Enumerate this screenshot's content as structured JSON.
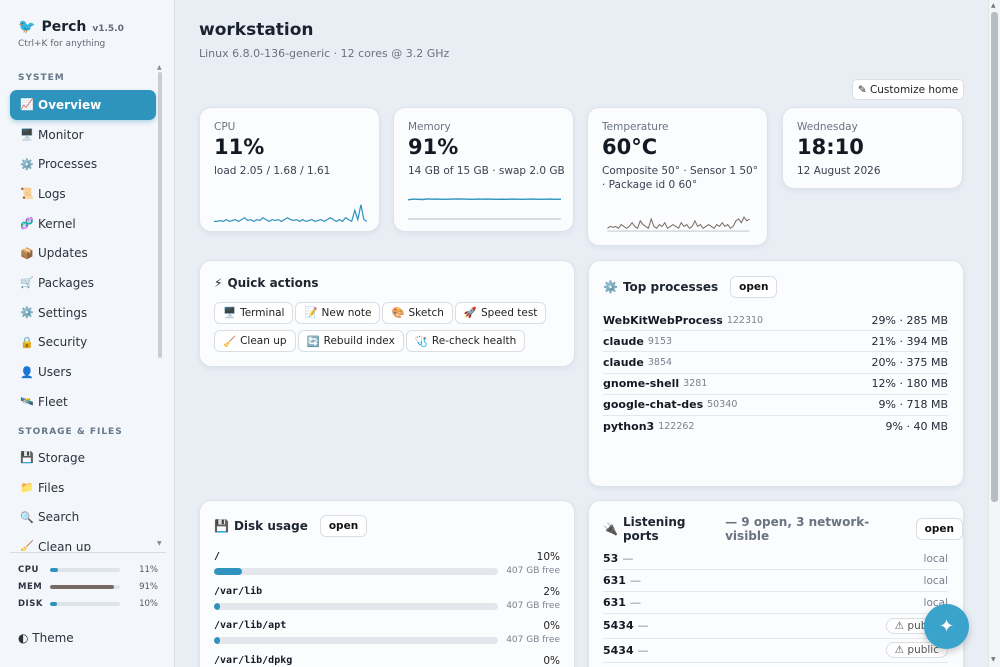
{
  "brand": {
    "icon": "bird-icon",
    "name": "Perch",
    "version": "v1.5.0",
    "hint": "Ctrl+K for anything"
  },
  "sidebar": {
    "system_title": "SYSTEM",
    "system_items": [
      {
        "icon": "📈",
        "label": "Overview",
        "active": true
      },
      {
        "icon": "🖥️",
        "label": "Monitor"
      },
      {
        "icon": "⚙️",
        "label": "Processes"
      },
      {
        "icon": "📜",
        "label": "Logs"
      },
      {
        "icon": "🧬",
        "label": "Kernel"
      },
      {
        "icon": "📦",
        "label": "Updates"
      },
      {
        "icon": "🛒",
        "label": "Packages"
      },
      {
        "icon": "⚙️",
        "label": "Settings"
      },
      {
        "icon": "🔒",
        "label": "Security"
      },
      {
        "icon": "👤",
        "label": "Users"
      },
      {
        "icon": "🛰️",
        "label": "Fleet"
      }
    ],
    "storage_title": "STORAGE & FILES",
    "storage_items": [
      {
        "icon": "💾",
        "label": "Storage"
      },
      {
        "icon": "📁",
        "label": "Files"
      },
      {
        "icon": "🔍",
        "label": "Search"
      },
      {
        "icon": "🧹",
        "label": "Clean up"
      }
    ],
    "meters": [
      {
        "label": "CPU",
        "value": "11%",
        "fraction": 0.11,
        "color": "#2e93bd"
      },
      {
        "label": "MEM",
        "value": "91%",
        "fraction": 0.91,
        "color": "#7a6a64"
      },
      {
        "label": "DISK",
        "value": "10%",
        "fraction": 0.1,
        "color": "#2e93bd"
      }
    ],
    "theme_label": "◐ Theme"
  },
  "header": {
    "title": "workstation",
    "subtitle": "Linux 6.8.0-136-generic · 12 cores @ 3.2 GHz",
    "customize_label": "✎ Customize home"
  },
  "stats": {
    "cpu": {
      "label": "CPU",
      "value": "11%",
      "sub": "load 2.05 / 1.68 / 1.61"
    },
    "memory": {
      "label": "Memory",
      "value": "91%",
      "sub": "14 GB of 15 GB · swap 2.0 GB"
    },
    "temperature": {
      "label": "Temperature",
      "value": "60°C",
      "sub": "Composite 50° · Sensor 1 50° · Package id 0 60°"
    },
    "clock": {
      "label": "Wednesday",
      "value": "18:10",
      "sub": "12 August 2026"
    }
  },
  "quick_actions": {
    "title": "Quick actions",
    "icon": "⚡",
    "buttons": [
      {
        "icon": "🖥️",
        "label": "Terminal"
      },
      {
        "icon": "📝",
        "label": "New note"
      },
      {
        "icon": "🎨",
        "label": "Sketch"
      },
      {
        "icon": "🚀",
        "label": "Speed test"
      },
      {
        "icon": "🧹",
        "label": "Clean up"
      },
      {
        "icon": "🔄",
        "label": "Rebuild index"
      },
      {
        "icon": "🩺",
        "label": "Re-check health"
      }
    ]
  },
  "top_processes": {
    "icon": "⚙️",
    "title": "Top processes",
    "open_label": "open",
    "rows": [
      {
        "name": "WebKitWebProcess",
        "pid": "122310",
        "stat": "29% · 285 MB"
      },
      {
        "name": "claude",
        "pid": "9153",
        "stat": "21% · 394 MB"
      },
      {
        "name": "claude",
        "pid": "3854",
        "stat": "20% · 375 MB"
      },
      {
        "name": "gnome-shell",
        "pid": "3281",
        "stat": "12% · 180 MB"
      },
      {
        "name": "google-chat-des",
        "pid": "50340",
        "stat": "9% · 718 MB"
      },
      {
        "name": "python3",
        "pid": "122262",
        "stat": "9% · 40 MB"
      }
    ]
  },
  "disk_usage": {
    "icon": "💾",
    "title": "Disk usage",
    "open_label": "open",
    "items": [
      {
        "path": "/",
        "pct": "10%",
        "fraction": 0.1,
        "free": "407 GB free"
      },
      {
        "path": "/var/lib",
        "pct": "2%",
        "fraction": 0.02,
        "free": "407 GB free"
      },
      {
        "path": "/var/lib/apt",
        "pct": "0%",
        "fraction": 0.0,
        "free": "407 GB free"
      },
      {
        "path": "/var/lib/dpkg",
        "pct": "0%",
        "fraction": 0.0,
        "free": ""
      }
    ]
  },
  "ports": {
    "icon": "🔌",
    "title": "Listening ports",
    "summary": "— 9 open, 3 network-visible",
    "open_label": "open",
    "rows": [
      {
        "port": "53",
        "dash": "—",
        "scope": "local"
      },
      {
        "port": "631",
        "dash": "—",
        "scope": "local"
      },
      {
        "port": "631",
        "dash": "—",
        "scope": "local"
      },
      {
        "port": "5434",
        "dash": "—",
        "scope": "⚠ public"
      },
      {
        "port": "5434",
        "dash": "—",
        "scope": "⚠ public"
      }
    ]
  },
  "fab": {
    "icon": "sparkle-icon",
    "glyph": "✦"
  },
  "colors": {
    "accent": "#2e93bd",
    "spark_cpu": "#2e93bd",
    "spark_temp": "#7a6a64"
  },
  "sparklines": {
    "cpu": [
      3,
      3,
      3.5,
      3,
      4,
      3,
      3.5,
      4,
      3,
      4,
      5,
      3.5,
      4,
      3,
      4,
      3.5,
      5,
      4,
      3,
      4,
      3.5,
      4,
      3,
      4,
      5,
      4,
      3.5,
      4,
      3,
      4,
      3,
      3.5,
      4,
      3,
      3.5,
      4,
      3,
      4,
      5,
      4,
      3,
      4,
      3,
      5,
      4,
      3,
      9,
      4,
      12,
      4,
      3
    ],
    "memory": [
      14,
      14.5,
      14.3,
      14.2,
      14.6,
      14.4,
      14.5,
      14.3,
      14.4,
      14.5,
      14.6,
      14.5,
      14.4,
      14.3,
      14.5,
      14.4,
      14.5,
      14.4,
      14.3,
      14.4,
      14.3,
      14.5,
      14.4,
      14.3,
      14.4,
      14.5,
      14.4,
      14.3,
      14.4,
      14.5,
      14.3,
      14.4
    ],
    "temperature": [
      2,
      3,
      2.5,
      3,
      2,
      4,
      3,
      2,
      3,
      5,
      3,
      2,
      6,
      4,
      3,
      2,
      7,
      3,
      2,
      4,
      3,
      5,
      2,
      3,
      4,
      3,
      2,
      5,
      3,
      4,
      2,
      3,
      6,
      3,
      4,
      2,
      3,
      4,
      3,
      2,
      4,
      3,
      5,
      3,
      4,
      2,
      3,
      6,
      7,
      5,
      8,
      6,
      7
    ]
  }
}
